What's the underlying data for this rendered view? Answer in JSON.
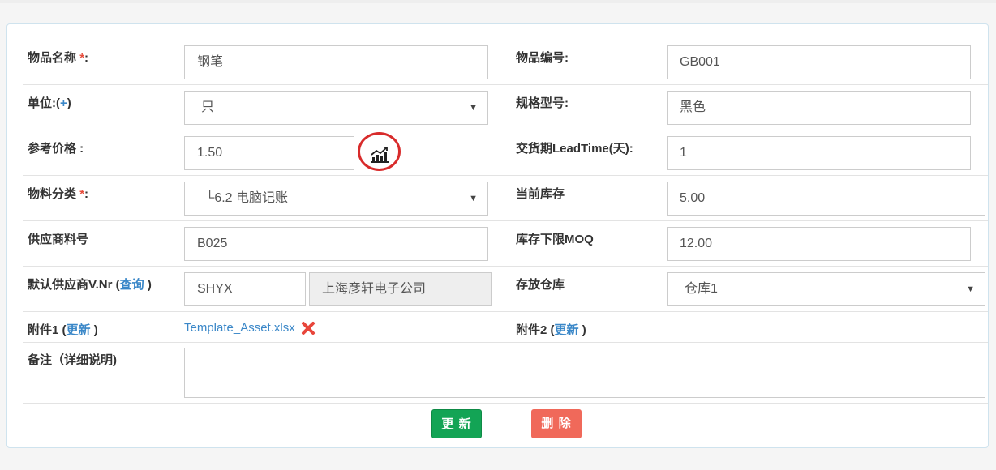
{
  "fields": {
    "item_name": {
      "label": "物品名称",
      "required_mark": "*",
      "colon": ":",
      "value": "钢笔"
    },
    "item_code": {
      "label": "物品编号:",
      "value": "GB001"
    },
    "unit": {
      "label": "单位:(",
      "add_link": "+",
      "label_end": ")",
      "value": "只"
    },
    "spec": {
      "label": "规格型号:",
      "value": "黑色"
    },
    "ref_price": {
      "label": "参考价格 :",
      "value": "1.50"
    },
    "lead_time": {
      "label": "交货期LeadTime(天):",
      "value": "1"
    },
    "category": {
      "label": "物料分类",
      "required_mark": "*",
      "colon": ":",
      "value": "└6.2 电脑记账"
    },
    "current_stock": {
      "label": "当前库存",
      "value": "5.00"
    },
    "supplier_part_no": {
      "label": "供应商料号",
      "value": "B025"
    },
    "moq": {
      "label": "库存下限MOQ",
      "value": "12.00"
    },
    "default_supplier": {
      "label": "默认供应商V.Nr (",
      "query_link": "查询",
      "label_end": ")",
      "code": "SHYX",
      "name": "上海彦轩电子公司"
    },
    "warehouse": {
      "label": "存放仓库",
      "value": "仓库1"
    },
    "attachment1": {
      "label": "附件1 (",
      "update_link": "更新",
      "label_end": ")",
      "file": "Template_Asset.xlsx"
    },
    "attachment2": {
      "label": "附件2 (",
      "update_link": "更新",
      "label_end": ")"
    },
    "remark": {
      "label": "备注（详细说明)",
      "value": ""
    }
  },
  "buttons": {
    "update": "更 新",
    "delete": "删 除"
  },
  "icons": {
    "dropdown": "dropdown-arrow-icon",
    "chart": "line-chart-icon",
    "delete": "delete-x-icon"
  },
  "colors": {
    "update": "#13a455",
    "delete": "#f0695a",
    "link": "#3a87c8",
    "required": "#e74c3c",
    "highlight_circle": "#d82b2b"
  }
}
